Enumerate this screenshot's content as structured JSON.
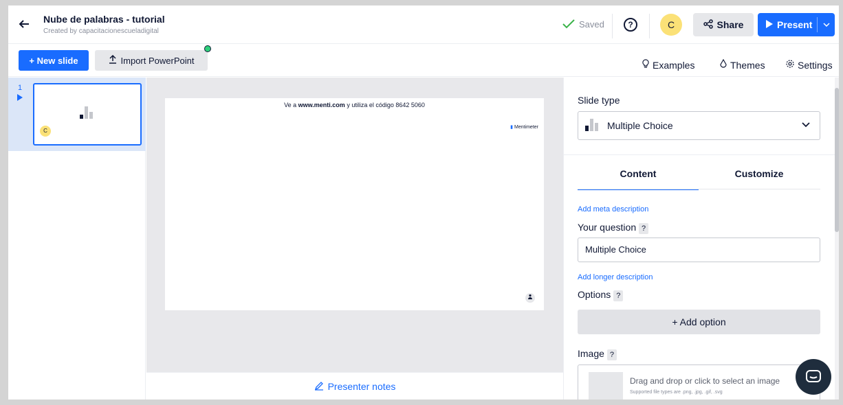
{
  "header": {
    "back_icon": "arrow-left-icon",
    "title": "Nube de palabras - tutorial",
    "creator": "Created by capacitacionescueladigital",
    "saved_label": "Saved",
    "avatar_initial": "C",
    "share_label": "Share",
    "present_label": "Present"
  },
  "toolbar": {
    "new_slide_label": "+ New slide",
    "import_label": "Import PowerPoint",
    "examples_label": "Examples",
    "themes_label": "Themes",
    "settings_label": "Settings"
  },
  "slides": [
    {
      "number": "1",
      "avatar": "C"
    }
  ],
  "canvas": {
    "instruction_prefix": "Ve a ",
    "instruction_url": "www.menti.com",
    "instruction_suffix": " y utiliza el código 8642 5060",
    "logo": "Mentimeter"
  },
  "presenter_notes_label": "Presenter notes",
  "panel": {
    "slide_type_label": "Slide type",
    "slide_type_value": "Multiple Choice",
    "tabs": [
      {
        "label": "Content",
        "active": true
      },
      {
        "label": "Customize",
        "active": false
      }
    ],
    "add_meta": "Add meta description",
    "question_label": "Your question",
    "question_value": "Multiple Choice",
    "add_longer": "Add longer description",
    "options_label": "Options",
    "add_option_label": "+ Add option",
    "image_label": "Image",
    "drop_text": "Drag and drop or click to select an image",
    "drop_hint": "Supported file types are .png, .jpg, .gif, .svg",
    "help_mark": "?"
  },
  "colors": {
    "accent": "#196cff",
    "avatar": "#fbe177",
    "saved_check": "#3bb34a"
  }
}
